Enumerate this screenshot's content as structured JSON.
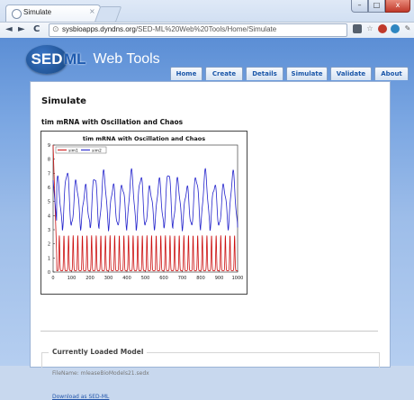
{
  "browser": {
    "tab_title": "Simulate",
    "tab_close": "×",
    "url_protocol": "sysbioapps.dyndns.org",
    "url_path": "/SED-ML%20Web%20Tools/Home/Simulate",
    "back": "◄",
    "forward": "►",
    "reload": "C",
    "window_minimize": "–",
    "window_maximize": "□",
    "window_close": "x"
  },
  "site": {
    "logo_sed": "SED",
    "logo_ml": "ML",
    "logo_tools": "Web Tools"
  },
  "nav": {
    "items": [
      "Home",
      "Create",
      "Details",
      "Simulate",
      "Validate",
      "About"
    ]
  },
  "main": {
    "page_title": "Simulate",
    "model_heading": "tim mRNA with Oscillation and Chaos",
    "loaded_title": "Currently Loaded Model",
    "filename": "FileName: mleaseBioModels21.sedx",
    "download": "Download as SED-ML"
  },
  "chart_data": {
    "type": "line",
    "title": "tim mRNA with Oscillation and Chaos",
    "xlim": [
      0,
      1000
    ],
    "ylim": [
      0,
      9
    ],
    "xticks": [
      0,
      100,
      200,
      300,
      400,
      500,
      600,
      700,
      800,
      900,
      1000
    ],
    "yticks": [
      0,
      1,
      2,
      3,
      4,
      5,
      6,
      7,
      8,
      9
    ],
    "xlabel": "",
    "ylabel": "",
    "legend_position": "top-left",
    "series": [
      {
        "name": "sim1",
        "color": "#cc1111",
        "base": 0.1,
        "amplitude": 2.5,
        "period": 25
      },
      {
        "name": "sim2",
        "color": "#2222cc",
        "base": 3.2,
        "amplitude": 3.9,
        "period": 50
      }
    ]
  }
}
